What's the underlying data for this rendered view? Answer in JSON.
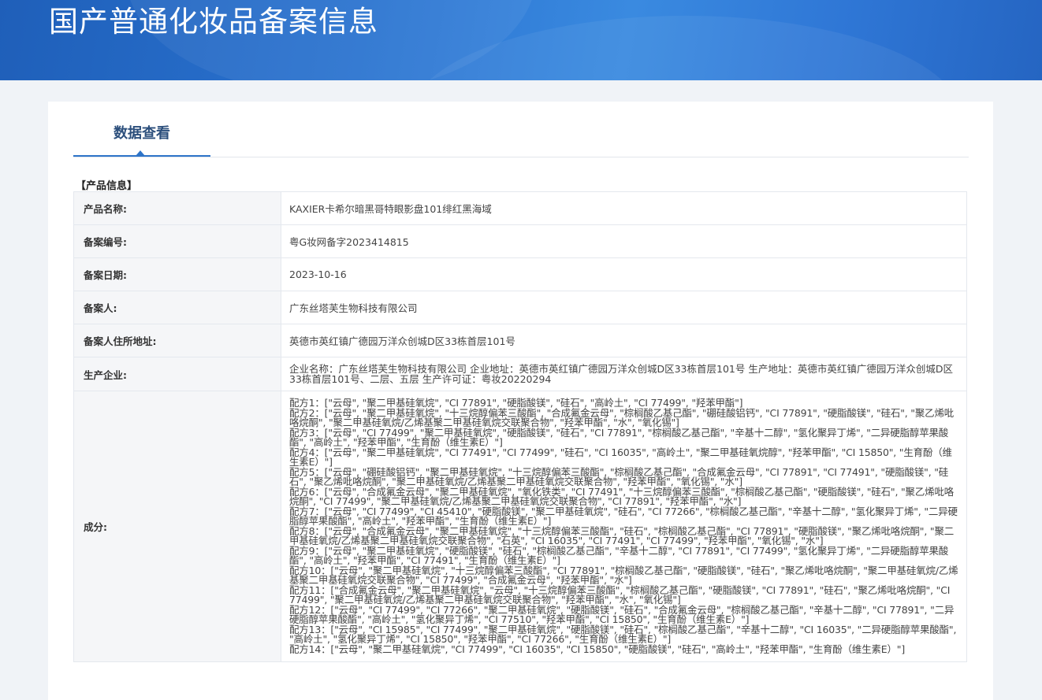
{
  "header": {
    "title": "国产普通化妆品备案信息"
  },
  "tabs": [
    {
      "label": "数据查看"
    }
  ],
  "section": {
    "title": "【产品信息】"
  },
  "rows": [
    {
      "label": "产品名称:",
      "value": "KAXIER卡希尔暗黑哥特眼影盘101绯红黑海域"
    },
    {
      "label": "备案编号:",
      "value": "粤G妆网备字2023414815"
    },
    {
      "label": "备案日期:",
      "value": "2023-10-16"
    },
    {
      "label": "备案人:",
      "value": "广东丝塔芙生物科技有限公司"
    },
    {
      "label": "备案人住所地址:",
      "value": "英德市英红镇广德园万洋众创城D区33栋首层101号"
    },
    {
      "label": "生产企业:",
      "value": "企业名称：广东丝塔芙生物科技有限公司 企业地址：英德市英红镇广德园万洋众创城D区33栋首层101号 生产地址：英德市英红镇广德园万洋众创城D区33栋首层101号、二层、五层 生产许可证：粤妆20220294"
    }
  ],
  "ingredients": {
    "label": "成分:",
    "formulas": [
      "配方1：[\"云母\", \"聚二甲基硅氧烷\", \"CI 77891\", \"硬脂酸镁\", \"硅石\", \"高岭土\", \"CI 77499\", \"羟苯甲酯\"]",
      "配方2：[\"云母\", \"聚二甲基硅氧烷\", \"十三烷醇偏苯三酸酯\", \"合成氟金云母\", \"棕榈酸乙基己酯\", \"硼硅酸铝钙\", \"CI 77891\", \"硬脂酸镁\", \"硅石\", \"聚乙烯吡咯烷酮\", \"聚二甲基硅氧烷/乙烯基聚二甲基硅氧烷交联聚合物\", \"羟苯甲酯\", \"水\", \"氧化锡\"]",
      "配方3：[\"云母\", \"CI 77499\", \"聚二甲基硅氧烷\", \"硬脂酸镁\", \"硅石\", \"CI 77891\", \"棕榈酸乙基己酯\", \"辛基十二醇\", \"氢化聚异丁烯\", \"二异硬脂醇苹果酸酯\", \"高岭土\", \"羟苯甲酯\", \"生育酚（维生素E）\"]",
      "配方4：[\"云母\", \"聚二甲基硅氧烷\", \"CI 77491\", \"CI 77499\", \"硅石\", \"CI 16035\", \"高岭土\", \"聚二甲基硅氧烷醇\", \"羟苯甲酯\", \"CI 15850\", \"生育酚（维生素E）\"]",
      "配方5：[\"云母\", \"硼硅酸铝钙\", \"聚二甲基硅氧烷\", \"十三烷醇偏苯三酸酯\", \"棕榈酸乙基己酯\", \"合成氟金云母\", \"CI 77891\", \"CI 77491\", \"硬脂酸镁\", \"硅石\", \"聚乙烯吡咯烷酮\", \"聚二甲基硅氧烷/乙烯基聚二甲基硅氧烷交联聚合物\", \"羟苯甲酯\", \"氧化锡\", \"水\"]",
      "配方6：[\"云母\", \"合成氟金云母\", \"聚二甲基硅氧烷\", \"氧化铁类\", \"CI 77491\", \"十三烷醇偏苯三酸酯\", \"棕榈酸乙基己酯\", \"硬脂酸镁\", \"硅石\", \"聚乙烯吡咯烷酮\", \"CI 77499\", \"聚二甲基硅氧烷/乙烯基聚二甲基硅氧烷交联聚合物\", \"CI 77891\", \"羟苯甲酯\", \"水\"]",
      "配方7：[\"云母\", \"CI 77499\", \"CI 45410\", \"硬脂酸镁\", \"聚二甲基硅氧烷\", \"硅石\", \"CI 77266\", \"棕榈酸乙基己酯\", \"辛基十二醇\", \"氢化聚异丁烯\", \"二异硬脂醇苹果酸酯\", \"高岭土\", \"羟苯甲酯\", \"生育酚（维生素E）\"]",
      "配方8：[\"云母\", \"合成氟金云母\", \"聚二甲基硅氧烷\", \"十三烷醇偏苯三酸酯\", \"硅石\", \"棕榈酸乙基己酯\", \"CI 77891\", \"硬脂酸镁\", \"聚乙烯吡咯烷酮\", \"聚二甲基硅氧烷/乙烯基聚二甲基硅氧烷交联聚合物\", \"石英\", \"CI 16035\", \"CI 77491\", \"CI 77499\", \"羟苯甲酯\", \"氧化锡\", \"水\"]",
      "配方9：[\"云母\", \"聚二甲基硅氧烷\", \"硬脂酸镁\", \"硅石\", \"棕榈酸乙基己酯\", \"辛基十二醇\", \"CI 77891\", \"CI 77499\", \"氢化聚异丁烯\", \"二异硬脂醇苹果酸酯\", \"高岭土\", \"羟苯甲酯\", \"CI 77491\", \"生育酚（维生素E）\"]",
      "配方10：[\"云母\", \"聚二甲基硅氧烷\", \"十三烷醇偏苯三酸酯\", \"CI 77891\", \"棕榈酸乙基己酯\", \"硬脂酸镁\", \"硅石\", \"聚乙烯吡咯烷酮\", \"聚二甲基硅氧烷/乙烯基聚二甲基硅氧烷交联聚合物\", \"CI 77499\", \"合成氟金云母\", \"羟苯甲酯\", \"水\"]",
      "配方11：[\"合成氟金云母\", \"聚二甲基硅氧烷\", \"云母\", \"十三烷醇偏苯三酸酯\", \"棕榈酸乙基己酯\", \"硬脂酸镁\", \"CI 77891\", \"硅石\", \"聚乙烯吡咯烷酮\", \"CI 77499\", \"聚二甲基硅氧烷/乙烯基聚二甲基硅氧烷交联聚合物\", \"羟苯甲酯\", \"水\", \"氧化锡\"]",
      "配方12：[\"云母\", \"CI 77499\", \"CI 77266\", \"聚二甲基硅氧烷\", \"硬脂酸镁\", \"硅石\", \"合成氟金云母\", \"棕榈酸乙基己酯\", \"辛基十二醇\", \"CI 77891\", \"二异硬脂醇苹果酸酯\", \"高岭土\", \"氢化聚异丁烯\", \"CI 77510\", \"羟苯甲酯\", \"CI 15850\", \"生育酚（维生素E）\"]",
      "配方13：[\"云母\", \"CI 15985\", \"CI 77499\", \"聚二甲基硅氧烷\", \"硬脂酸镁\", \"硅石\", \"棕榈酸乙基己酯\", \"辛基十二醇\", \"CI 16035\", \"二异硬脂醇苹果酸酯\", \"高岭土\", \"氢化聚异丁烯\", \"CI 15850\", \"羟苯甲酯\", \"CI 77266\", \"生育酚（维生素E）\"]",
      "配方14：[\"云母\", \"聚二甲基硅氧烷\", \"CI 77499\", \"CI 16035\", \"CI 15850\", \"硬脂酸镁\", \"硅石\", \"高岭土\", \"羟苯甲酯\", \"生育酚（维生素E）\"]"
    ]
  },
  "colors": {
    "banner": "#2a73d0",
    "accent": "#2e74c8",
    "tab_text": "#2c4f7c"
  }
}
